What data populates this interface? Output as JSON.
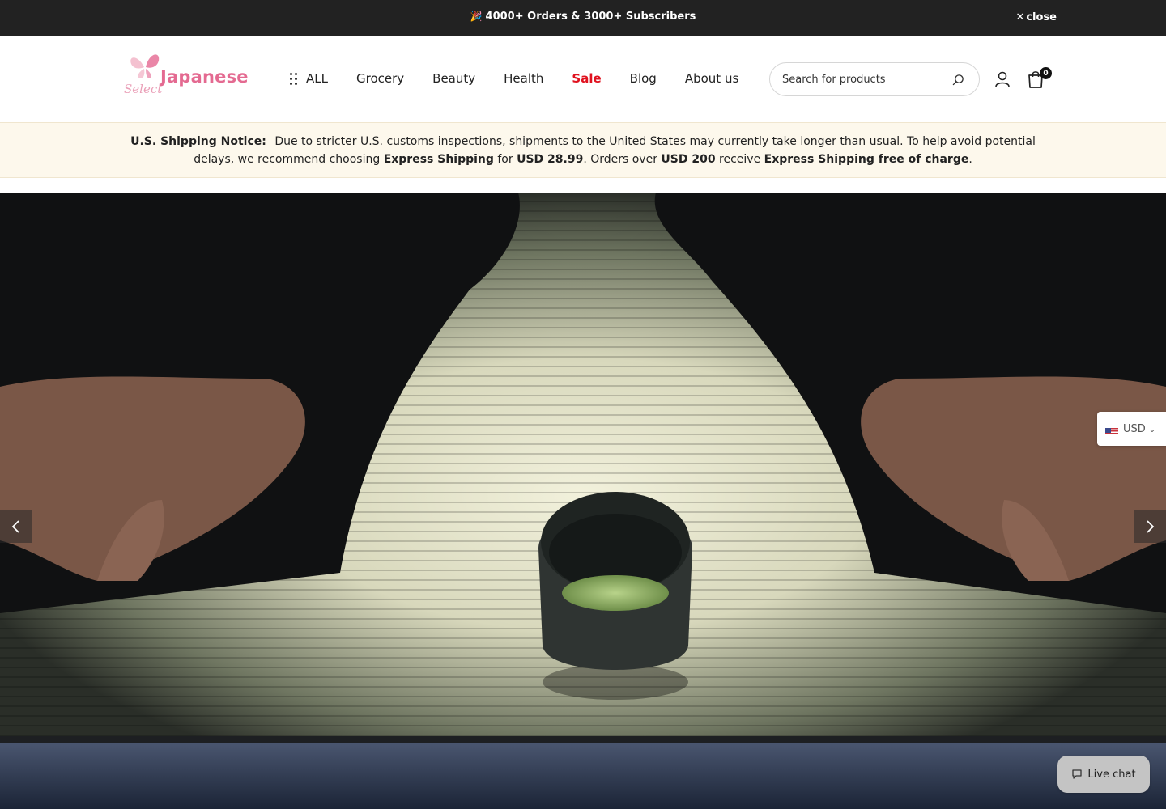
{
  "announcement": {
    "icon": "party-popper-icon",
    "text": "4000+ Orders & 3000+ Subscribers",
    "close_label": "close"
  },
  "header": {
    "logo": {
      "word": "Japanese",
      "script": "Select"
    },
    "nav": [
      {
        "label": "ALL"
      },
      {
        "label": "Grocery"
      },
      {
        "label": "Beauty"
      },
      {
        "label": "Health"
      },
      {
        "label": "Sale",
        "highlight_color": "#e0121f"
      },
      {
        "label": "Blog"
      },
      {
        "label": "About us"
      }
    ],
    "search": {
      "placeholder": "Search for products"
    },
    "cart_count": "0"
  },
  "notice": {
    "lead": "U.S. Shipping Notice:",
    "text1": "Due to stricter U.S. customs inspections, shipments to the United States may currently take longer than usual. To help avoid potential delays, we recommend choosing ",
    "bold1": "Express Shipping",
    "text2": " for ",
    "bold2": "USD 28.99",
    "text3": ". Orders over ",
    "bold3": "USD 200",
    "text4": " receive ",
    "bold4": "Express Shipping free of charge",
    "text5": "."
  },
  "hero": {
    "prev_icon": "chevron-left-icon",
    "next_icon": "chevron-right-icon"
  },
  "currency": {
    "code": "USD",
    "flag": "us-flag-icon"
  },
  "live_chat": {
    "label": "Live chat"
  },
  "colors": {
    "topbar": "#222222",
    "brand_pink": "#e46a91",
    "sale_red": "#e0121f",
    "notice_bg": "#fdf8ec"
  }
}
